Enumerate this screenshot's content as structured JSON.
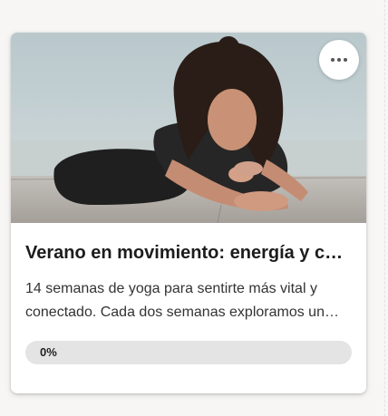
{
  "card": {
    "title": "Verano en movimiento: energía y conexión",
    "description": "14 semanas de yoga para sentirte más vital y conectado. Cada dos semanas exploramos un nuevo tema.",
    "progress": {
      "value": 0,
      "label": "0%"
    },
    "image": {
      "subject": "woman-yoga-forward-fold-photo"
    },
    "menu": {
      "icon": "more-horizontal-icon"
    }
  },
  "colors": {
    "progress_track": "#e4e4e4",
    "title": "#1c1c1c",
    "text": "#333333"
  }
}
